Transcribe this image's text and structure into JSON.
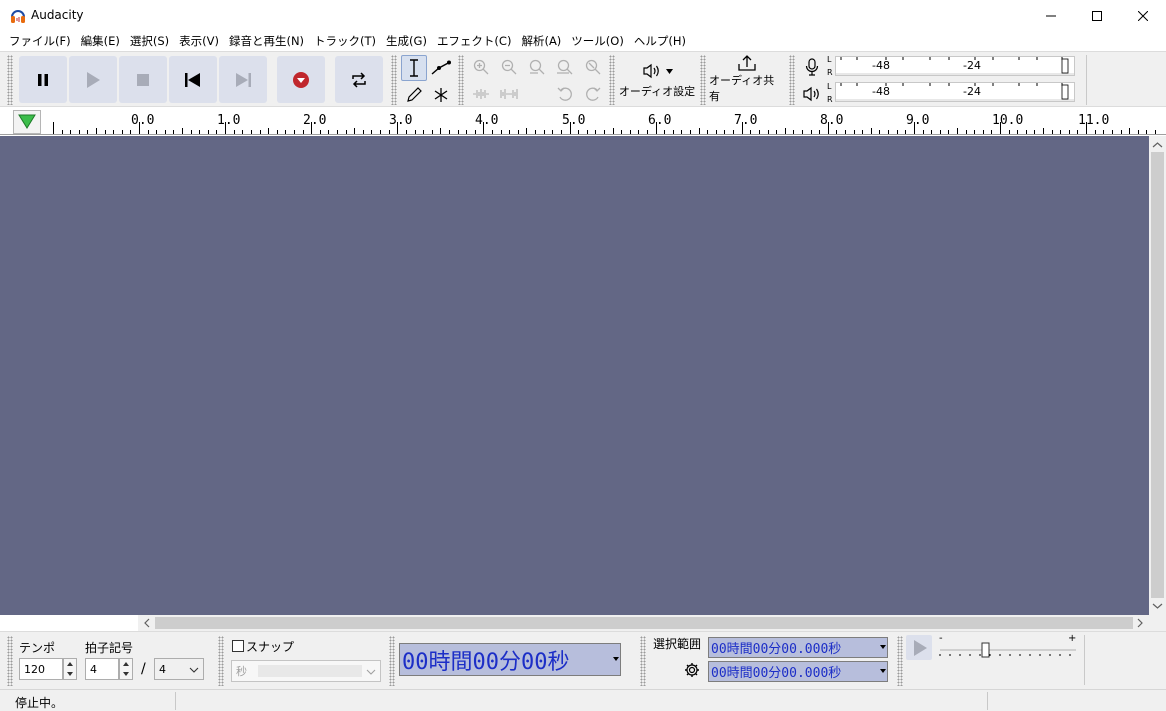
{
  "window": {
    "title": "Audacity",
    "controls": {
      "minimize": "—",
      "maximize": "☐",
      "close": "✕"
    }
  },
  "menu": [
    "ファイル(F)",
    "編集(E)",
    "選択(S)",
    "表示(V)",
    "録音と再生(N)",
    "トラック(T)",
    "生成(G)",
    "エフェクト(C)",
    "解析(A)",
    "ツール(O)",
    "ヘルプ(H)"
  ],
  "toolbar": {
    "transport": [
      "pause-icon",
      "play-icon",
      "stop-icon",
      "skip-to-start-icon",
      "skip-to-end-icon",
      "record-icon",
      "loop-icon"
    ],
    "audio_setup_label": "オーディオ設定",
    "audio_setup_icon": "speaker-icon",
    "share_audio_label": "オーディオ共有",
    "share_audio_icon": "share-icon",
    "meter": {
      "record_icon": "microphone-icon",
      "play_icon": "speaker-icon",
      "l": "L",
      "r": "R",
      "tick_48": "-48",
      "tick_24": "-24"
    }
  },
  "ruler": {
    "labels": [
      "0.0",
      "1.0",
      "2.0",
      "3.0",
      "4.0",
      "5.0",
      "6.0",
      "7.0",
      "8.0",
      "9.0",
      "10.0",
      "11.0"
    ]
  },
  "bottom": {
    "tempo_label": "テンポ",
    "tempo_value": "120",
    "time_sig_label": "拍子記号",
    "time_sig_top": "4",
    "time_sig_slash": "/",
    "time_sig_bottom": "4",
    "snap_label": "スナップ",
    "snap_unit": "秒",
    "time_display": "00時間00分00秒",
    "selection_label": "選択範囲",
    "selection_start": "00時間00分00.000秒",
    "selection_end": "00時間00分00.000秒",
    "speed_minus": "-",
    "speed_plus": "+"
  },
  "status": {
    "text": "停止中。"
  },
  "colors": {
    "track_bg": "#636785",
    "time_bg": "#b7bedc",
    "time_fg": "#1c2ec7",
    "record": "#c0272d"
  }
}
